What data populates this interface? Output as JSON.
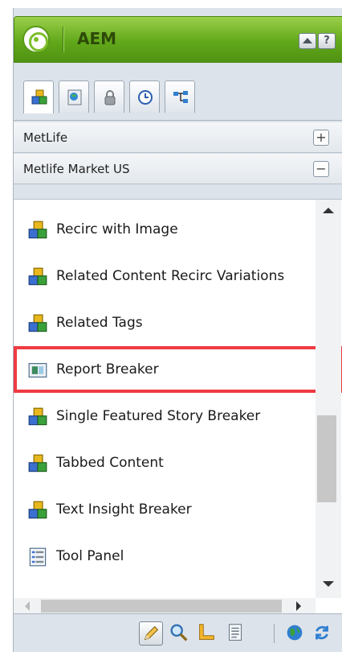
{
  "header": {
    "title": "AEM",
    "collapse_icon": "collapse-icon",
    "help_label": "?"
  },
  "tabs": [
    {
      "icon": "components-icon",
      "active": true
    },
    {
      "icon": "page-icon",
      "active": false
    },
    {
      "icon": "lock-icon",
      "active": false
    },
    {
      "icon": "clock-icon",
      "active": false
    },
    {
      "icon": "workflow-icon",
      "active": false
    }
  ],
  "groups": [
    {
      "label": "MetLife",
      "toggle": "+"
    },
    {
      "label": "Metlife Market US",
      "toggle": "−"
    }
  ],
  "components": [
    {
      "label": "Recirc with Image",
      "icon": "component-icon"
    },
    {
      "label": "Related Content Recirc Variations",
      "icon": "component-icon"
    },
    {
      "label": "Related Tags",
      "icon": "component-icon"
    },
    {
      "label": "Report Breaker",
      "icon": "report-icon",
      "highlighted": true
    },
    {
      "label": "Single Featured Story Breaker",
      "icon": "component-icon"
    },
    {
      "label": "Tabbed Content",
      "icon": "component-icon"
    },
    {
      "label": "Text Insight Breaker",
      "icon": "component-icon"
    },
    {
      "label": "Tool Panel",
      "icon": "list-icon"
    }
  ],
  "toolbar": [
    "edit-pencil-icon",
    "preview-magnifier-icon",
    "design-ruler-icon",
    "page-properties-icon",
    "website-globe-icon",
    "refresh-icon"
  ],
  "colors": {
    "highlight": "#ef3b43",
    "header": "#62a81b"
  }
}
